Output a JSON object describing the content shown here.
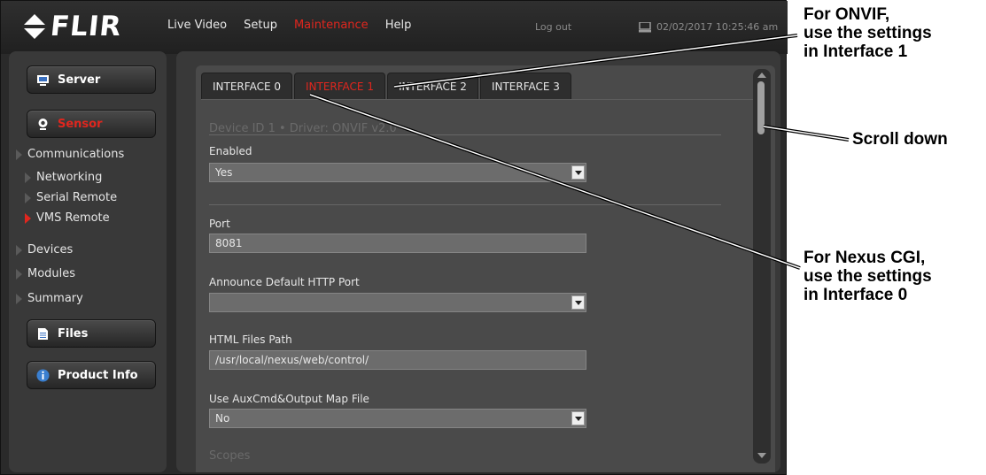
{
  "app": {
    "logo_text": "FLIR",
    "nav": [
      "Live Video",
      "Setup",
      "Maintenance",
      "Help"
    ],
    "nav_active": "Maintenance",
    "logout": "Log out",
    "datetime": "02/02/2017 10:25:46 am"
  },
  "sidebar": {
    "server": "Server",
    "sensor": "Sensor",
    "items": {
      "communications": "Communications",
      "networking": "Networking",
      "serial_remote": "Serial Remote",
      "vms_remote": "VMS Remote",
      "devices": "Devices",
      "modules": "Modules",
      "summary": "Summary"
    },
    "files": "Files",
    "product_info": "Product Info"
  },
  "tabs": [
    "INTERFACE 0",
    "INTERFACE 1",
    "INTERFACE 2",
    "INTERFACE 3"
  ],
  "active_tab": "INTERFACE 1",
  "form": {
    "section_device": "Device ID 1  •  Driver: ONVIF v2.0",
    "enabled_label": "Enabled",
    "enabled_value": "Yes",
    "port_label": "Port",
    "port_value": "8081",
    "announce_label": "Announce Default HTTP Port",
    "announce_value": "",
    "html_path_label": "HTML Files Path",
    "html_path_value": "/usr/local/nexus/web/control/",
    "auxcmd_label": "Use AuxCmd&Output Map File",
    "auxcmd_value": "No",
    "section_scopes": "Scopes"
  },
  "annotations": {
    "onvif": [
      "For ONVIF,",
      "use the settings",
      "in Interface 1"
    ],
    "scroll": "Scroll down",
    "nexus": [
      "For Nexus CGI,",
      "use the settings",
      "in Interface 0"
    ]
  },
  "colors": {
    "accent_red": "#e0261e",
    "panel": "#393939",
    "content": "#4a4a4a"
  }
}
